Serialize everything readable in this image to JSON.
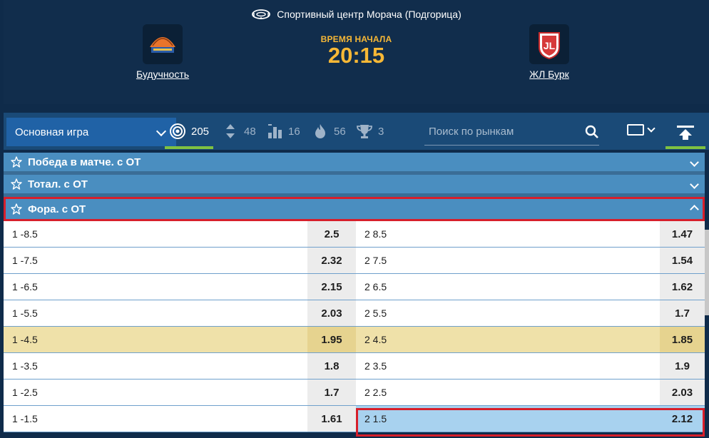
{
  "venue": "Спортивный центр Морача (Подгорица)",
  "home_team": {
    "name": "Будучность"
  },
  "away_team": {
    "name": "ЖЛ Бурк"
  },
  "start": {
    "label": "ВРЕМЯ НАЧАЛА",
    "time": "20:15"
  },
  "toolbar": {
    "game_select": "Основная игра",
    "stats": [
      {
        "icon": "target-icon",
        "count": "205"
      },
      {
        "icon": "sort-arrows-icon",
        "count": "48"
      },
      {
        "icon": "stats-bars-icon",
        "count": "16"
      },
      {
        "icon": "fire-icon",
        "count": "56"
      },
      {
        "icon": "trophy-icon",
        "count": "3"
      }
    ],
    "search_placeholder": "Поиск по рынкам"
  },
  "markets": [
    {
      "title": "Победа в матче. с ОТ",
      "expanded": false
    },
    {
      "title": "Тотал. с ОТ",
      "expanded": false
    },
    {
      "title": "Фора. с ОТ",
      "expanded": true
    }
  ],
  "handicap_rows": [
    {
      "label1": "1 -8.5",
      "odd1": "2.5",
      "label2": "2 8.5",
      "odd2": "1.47"
    },
    {
      "label1": "1 -7.5",
      "odd1": "2.32",
      "label2": "2 7.5",
      "odd2": "1.54"
    },
    {
      "label1": "1 -6.5",
      "odd1": "2.15",
      "label2": "2 6.5",
      "odd2": "1.62"
    },
    {
      "label1": "1 -5.5",
      "odd1": "2.03",
      "label2": "2 5.5",
      "odd2": "1.7"
    },
    {
      "label1": "1 -4.5",
      "odd1": "1.95",
      "label2": "2 4.5",
      "odd2": "1.85"
    },
    {
      "label1": "1 -3.5",
      "odd1": "1.8",
      "label2": "2 3.5",
      "odd2": "1.9"
    },
    {
      "label1": "1 -2.5",
      "odd1": "1.7",
      "label2": "2 2.5",
      "odd2": "2.03"
    },
    {
      "label1": "1 -1.5",
      "odd1": "1.61",
      "label2": "2 1.5",
      "odd2": "2.12"
    }
  ],
  "colors": {
    "accent": "#f7b836",
    "header_bg": "#112d4c",
    "market_bar": "#4a8ec0",
    "highlight": "#efe1a9",
    "selected": "#a8d2ef",
    "alert": "#d71f2b"
  }
}
